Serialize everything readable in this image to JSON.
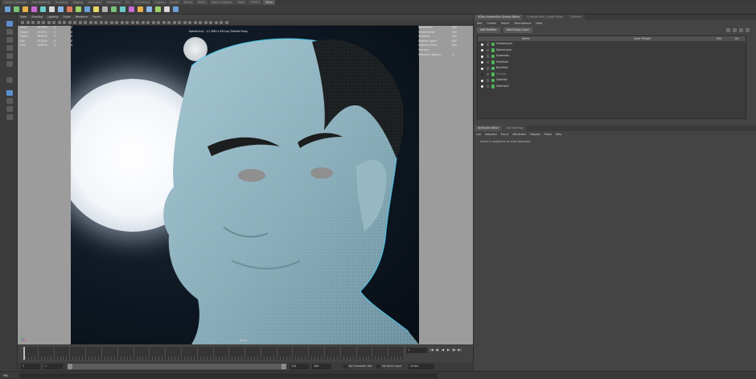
{
  "shelf": {
    "tabs": [
      "Curves / Surfaces",
      "Poly Modeling",
      "Sculpting",
      "Rigging",
      "Animation",
      "Rendering",
      "FX",
      "FX Caching",
      "Custom",
      "Arnold",
      "Bifrost",
      "MASH",
      "Motion Graphics",
      "XGen",
      "TURTLE",
      "XGen"
    ],
    "active_tab": 15,
    "icon_colors": [
      "#6aa0d8",
      "#78c27a",
      "#e7b24b",
      "#c86bd1",
      "#6cc9c9",
      "#d9d9d9",
      "#88b7e8",
      "#e07a5f",
      "#9fd36b",
      "#6aa0d8",
      "#e8d86a",
      "#b0b0b0",
      "#78c27a",
      "#6cc9c9",
      "#c86bd1",
      "#e7b24b",
      "#88b7e8",
      "#9fd36b",
      "#d9d9d9",
      "#6aa0d8"
    ]
  },
  "viewport": {
    "menu": [
      "View",
      "Shading",
      "Lighting",
      "Show",
      "Renderer",
      "Panels"
    ],
    "camera_label": "Sphere1cs1 - C1 (960 x 540 px) Turbtile Proxy",
    "view_name": "persp",
    "hud_left": {
      "headers": [
        "Verts:",
        "Edges:",
        "Faces:",
        "Tris:",
        "UVs:"
      ],
      "col1": [
        "161360",
        "321871",
        "160528",
        "321048",
        "329014"
      ],
      "col2": [
        "0",
        "0",
        "0",
        "0",
        "0"
      ],
      "col3": [
        "0",
        "0",
        "0",
        "0",
        "0"
      ]
    },
    "hud_right": {
      "labels": [
        "Backfaces:",
        "Smoothness:",
        "Instance:",
        "Display Layer:",
        "Distance From Camera:",
        "Selected Objects:"
      ],
      "values": [
        "N/A",
        "N/A",
        "N/A",
        "N/A",
        "N/A",
        "0"
      ]
    }
  },
  "timeline": {
    "current_frame": "1",
    "ticks": [
      "5",
      "10",
      "15",
      "20",
      "25",
      "30",
      "35",
      "40",
      "45",
      "50",
      "55",
      "60",
      "65",
      "70",
      "75",
      "80",
      "85",
      "90",
      "95",
      "100",
      "105",
      "110",
      "115",
      "120"
    ],
    "controls": [
      "|◀",
      "◀|",
      "◀",
      "▶",
      "|▶",
      "▶|"
    ]
  },
  "range": {
    "start": "1",
    "inner_start": "1",
    "inner_end": "120",
    "end": "200",
    "opts": [
      "No Character Set",
      "No Anim Layer"
    ],
    "fps": "24 fps"
  },
  "cmdline": {
    "label": "MEL"
  },
  "xgen": {
    "tabs": [
      "XGen Interactive Groom Editor",
      "Channel Box / Layer Editor",
      "Outliner"
    ],
    "menu": [
      "Edit",
      "Create",
      "Select",
      "Descriptions",
      "Help"
    ],
    "buttons": [
      "Add Modifier",
      "Add Empty Layer"
    ],
    "columns": [
      "Name",
      "Layer Weight",
      "Edit",
      "Vis"
    ],
    "layers": [
      {
        "name": "GroomLayer",
        "visible": true
      },
      {
        "name": "SplineLayer",
        "visible": true
      },
      {
        "name": "Eyebrows",
        "visible": true
      },
      {
        "name": "FrontHair",
        "visible": true
      },
      {
        "name": "BackHair",
        "visible": true
      },
      {
        "name": "Stubble",
        "visible": false
      },
      {
        "name": "SideHair",
        "visible": true
      },
      {
        "name": "SideHair2",
        "visible": true
      }
    ]
  },
  "attr": {
    "tabs": [
      "Attribute Editor",
      "Tool Settings"
    ],
    "menu": [
      "List",
      "Selected",
      "Focus",
      "Attributes",
      "Display",
      "Show",
      "Help"
    ],
    "message": "Select a node/item to view attributes"
  }
}
